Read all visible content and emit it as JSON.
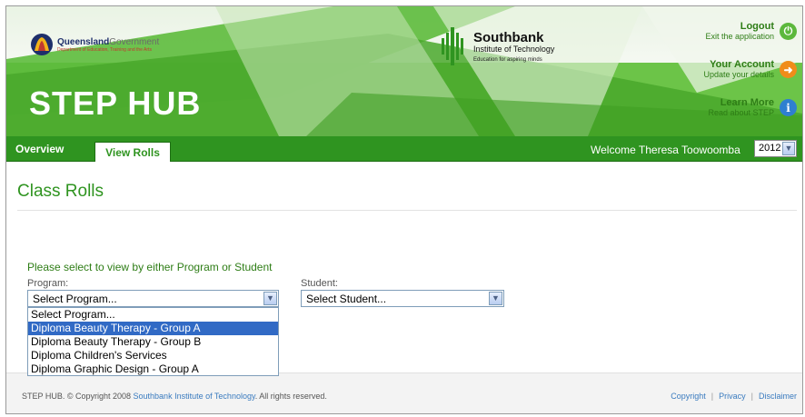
{
  "header": {
    "gov_name": "Queensland",
    "gov_suffix": "Government",
    "gov_dept": "Department of Education, Training and the Arts",
    "app_title": "STEP HUB",
    "institute_name": "Southbank",
    "institute_sub": "Institute of Technology",
    "institute_tag": "Education for aspiring minds",
    "links": [
      {
        "title": "Logout",
        "sub": "Exit the application",
        "icon": "power-icon",
        "color": "#5cb83c"
      },
      {
        "title": "Your Account",
        "sub": "Update your details",
        "icon": "arrow-right-icon",
        "color": "#f08c1a"
      },
      {
        "title": "Learn More",
        "sub": "Read about STEP",
        "icon": "info-icon",
        "color": "#2f7fd0"
      }
    ]
  },
  "nav": {
    "tabs": [
      {
        "label": "Overview",
        "active": false
      },
      {
        "label": "View Rolls",
        "active": true
      }
    ],
    "welcome": "Welcome Theresa Toowoomba",
    "year": "2012"
  },
  "main": {
    "title": "Class Rolls",
    "instruction": "Please select to view by either Program or Student",
    "program_label": "Program:",
    "program_value": "Select Program...",
    "program_options": [
      {
        "label": "Select Program...",
        "selected": false
      },
      {
        "label": "Diploma Beauty Therapy - Group A",
        "selected": true
      },
      {
        "label": "Diploma Beauty Therapy - Group B",
        "selected": false
      },
      {
        "label": "Diploma Children's Services",
        "selected": false
      },
      {
        "label": "Diploma Graphic Design - Group A",
        "selected": false
      }
    ],
    "student_label": "Student:",
    "student_value": "Select Student..."
  },
  "footer": {
    "copy_prefix": "STEP HUB. © Copyright 2008 ",
    "copy_link": "Southbank Institute of Technology",
    "copy_suffix": ". All rights reserved.",
    "links": [
      "Copyright",
      "Privacy",
      "Disclaimer"
    ]
  },
  "colors": {
    "brand_green": "#2f9420",
    "link_blue": "#3a7bbf"
  }
}
